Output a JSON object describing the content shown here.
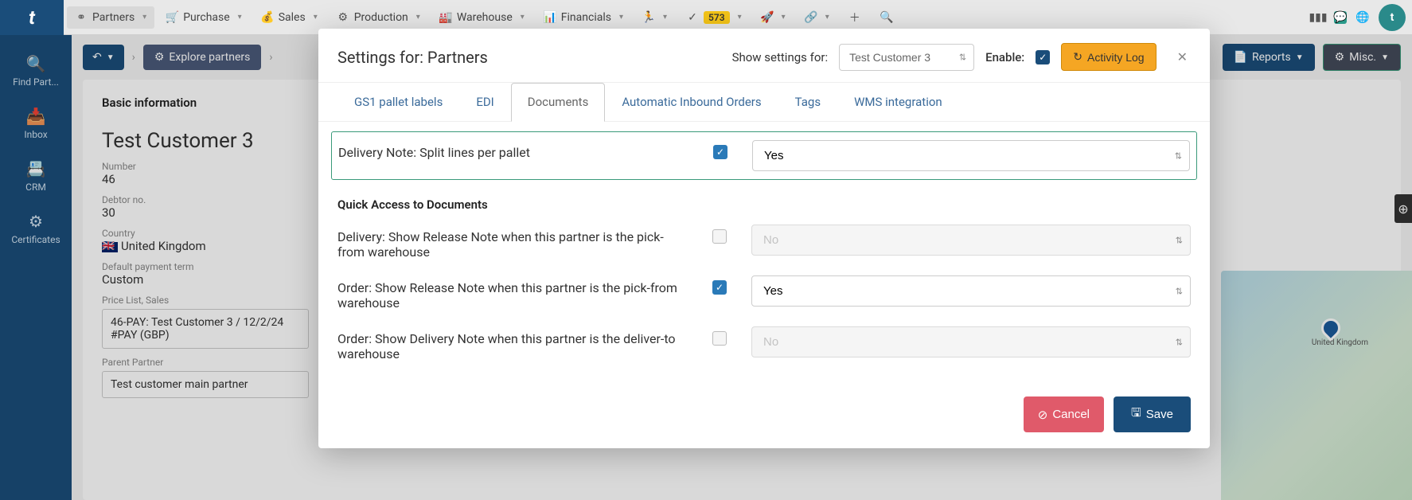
{
  "logo": "t",
  "topnav": {
    "items": [
      {
        "label": "Partners"
      },
      {
        "label": "Purchase"
      },
      {
        "label": "Sales"
      },
      {
        "label": "Production"
      },
      {
        "label": "Warehouse"
      },
      {
        "label": "Financials"
      }
    ],
    "badge": "573"
  },
  "sidenav": {
    "items": [
      {
        "label": "Find Part..."
      },
      {
        "label": "Inbox"
      },
      {
        "label": "CRM"
      },
      {
        "label": "Certificates"
      }
    ]
  },
  "subbar": {
    "explore": "Explore partners",
    "reports": "Reports",
    "misc": "Misc."
  },
  "bg": {
    "basic_info": "Basic information",
    "name": "Test Customer 3",
    "number_label": "Number",
    "number": "46",
    "debtor_label": "Debtor no.",
    "debtor": "30",
    "country_label": "Country",
    "country": "United Kingdom",
    "payment_label": "Default payment term",
    "payment": "Custom",
    "pricelist_label": "Price List, Sales",
    "pricelist": "46-PAY: Test Customer 3 / 12/2/24 #PAY (GBP)",
    "parent_label": "Parent Partner",
    "parent": "Test customer main partner"
  },
  "map": {
    "label": "United Kingdom"
  },
  "modal": {
    "title": "Settings for: Partners",
    "show_for_label": "Show settings for:",
    "show_for_value": "Test Customer 3",
    "enable_label": "Enable:",
    "activity_log": "Activity Log",
    "tabs": [
      {
        "label": "GS1 pallet labels"
      },
      {
        "label": "EDI"
      },
      {
        "label": "Documents"
      },
      {
        "label": "Automatic Inbound Orders"
      },
      {
        "label": "Tags"
      },
      {
        "label": "WMS integration"
      }
    ],
    "settings": [
      {
        "label": "Delivery Note: Split lines per pallet",
        "checked": true,
        "value": "Yes",
        "enabled": true,
        "highlighted": true
      }
    ],
    "section_head": "Quick Access to Documents",
    "quick_settings": [
      {
        "label": "Delivery: Show Release Note when this partner is the pick-from warehouse",
        "checked": false,
        "value": "No",
        "enabled": false
      },
      {
        "label": "Order: Show Release Note when this partner is the pick-from warehouse",
        "checked": true,
        "value": "Yes",
        "enabled": true
      },
      {
        "label": "Order: Show Delivery Note when this partner is the deliver-to warehouse",
        "checked": false,
        "value": "No",
        "enabled": false
      }
    ],
    "cancel": "Cancel",
    "save": "Save"
  }
}
